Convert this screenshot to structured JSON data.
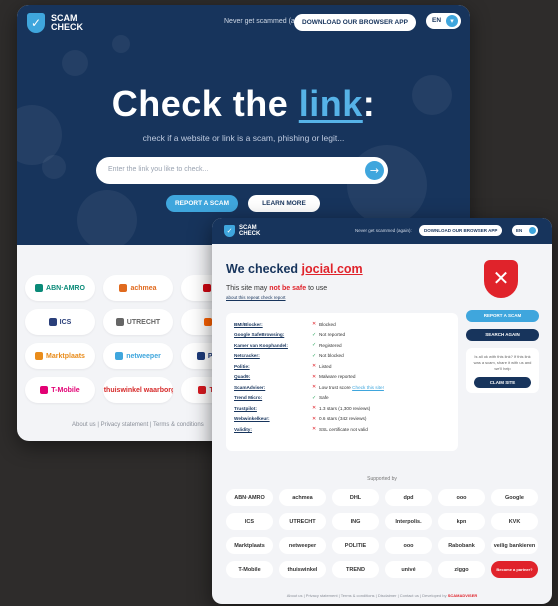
{
  "brand": {
    "line1": "SCAM",
    "line2": "CHECK"
  },
  "header": {
    "tagline": "Never get scammed (again):",
    "download_label": "DOWNLOAD OUR BROWSER APP",
    "language": "EN"
  },
  "hero": {
    "title_prefix": "Check the ",
    "title_link": "link",
    "title_suffix": ":",
    "subtitle": "check if a website or link is a scam, phishing or legit...",
    "search_placeholder": "Enter the link you like to check...",
    "report_button": "REPORT A SCAM",
    "learn_more_button": "LEARN MORE"
  },
  "home_partners": [
    {
      "name": "ABN·AMRO",
      "color": "#0a8a78"
    },
    {
      "name": "achmea",
      "color": "#e06a1e"
    },
    {
      "name": "DHL",
      "color": "#d40511"
    },
    {
      "name": "ICS",
      "color": "#2a3f7a"
    },
    {
      "name": "UTRECHT",
      "color": "#666666"
    },
    {
      "name": "ING",
      "color": "#ff6200"
    },
    {
      "name": "Marktplaats",
      "color": "#e98c1b"
    },
    {
      "name": "netweeper",
      "color": "#3fa6dd"
    },
    {
      "name": "POLITIE",
      "color": "#1d3a7a"
    },
    {
      "name": "T-Mobile",
      "color": "#e20074"
    },
    {
      "name": "thuiswinkel waarborg",
      "color": "#d62a2a"
    },
    {
      "name": "TREND",
      "color": "#d71920"
    }
  ],
  "home_footer": "About us | Privacy statement | Terms & conditions",
  "result": {
    "title_prefix": "We checked ",
    "domain": "jocial.com",
    "verdict_prefix": "This site may ",
    "verdict_bold": "not be safe",
    "verdict_suffix": " to use",
    "more_link": "about this repeat check report",
    "verdict_icon": "✕",
    "checks": [
      {
        "key": "BMI/Blocker:",
        "status": "bad",
        "value": "Blocked"
      },
      {
        "key": "Google SafeBrowsing:",
        "status": "ok",
        "value": "Not reported"
      },
      {
        "key": "Kamer van Koophandel:",
        "status": "ok",
        "value": "Registered"
      },
      {
        "key": "Netcracker:",
        "status": "ok",
        "value": "Not blocked"
      },
      {
        "key": "Politie:",
        "status": "bad",
        "value": "Listed"
      },
      {
        "key": "Quad9:",
        "status": "bad",
        "value": "Malware reported"
      },
      {
        "key": "ScamAdviser:",
        "status": "bad",
        "value": "Low trust score",
        "extra": "Check this site!"
      },
      {
        "key": "Trend Micro:",
        "status": "ok",
        "value": "Safe"
      },
      {
        "key": "Trustpilot:",
        "status": "bad",
        "value": "1.3 stars (1,300 reviews)"
      },
      {
        "key": "Webwinkelkeur:",
        "status": "bad",
        "value": "0.6 stars (342 reviews)"
      },
      {
        "key": "Validity:",
        "status": "bad",
        "value": "SSL certificate not valid"
      }
    ],
    "side_buttons": [
      "REPORT A SCAM",
      "SEARCH AGAIN"
    ],
    "side_text": "Is all ok with this link? If this link was a scam, share it with us and we'll help",
    "side_box_button": "CLAIM SITE"
  },
  "supported_by": "Supported by",
  "result_partners": [
    "ABN·AMRO",
    "achmea",
    "DHL",
    "dpd",
    "ooo",
    "Google",
    "ICS",
    "UTRECHT",
    "ING",
    "Interpolis.",
    "kpn",
    "KVK",
    "Marktplaats",
    "netweeper",
    "POLITIE",
    "ooo",
    "Rabobank",
    "veilig bankieren",
    "T-Mobile",
    "thuiswinkel",
    "TREND",
    "univé",
    "ziggo",
    "Become a partner?"
  ],
  "result_footer_prefix": "About us | Privacy statement | Terms & conditions | Disclaimer | Contact us | Developed by ",
  "result_footer_brand": "SCAMADVISER"
}
